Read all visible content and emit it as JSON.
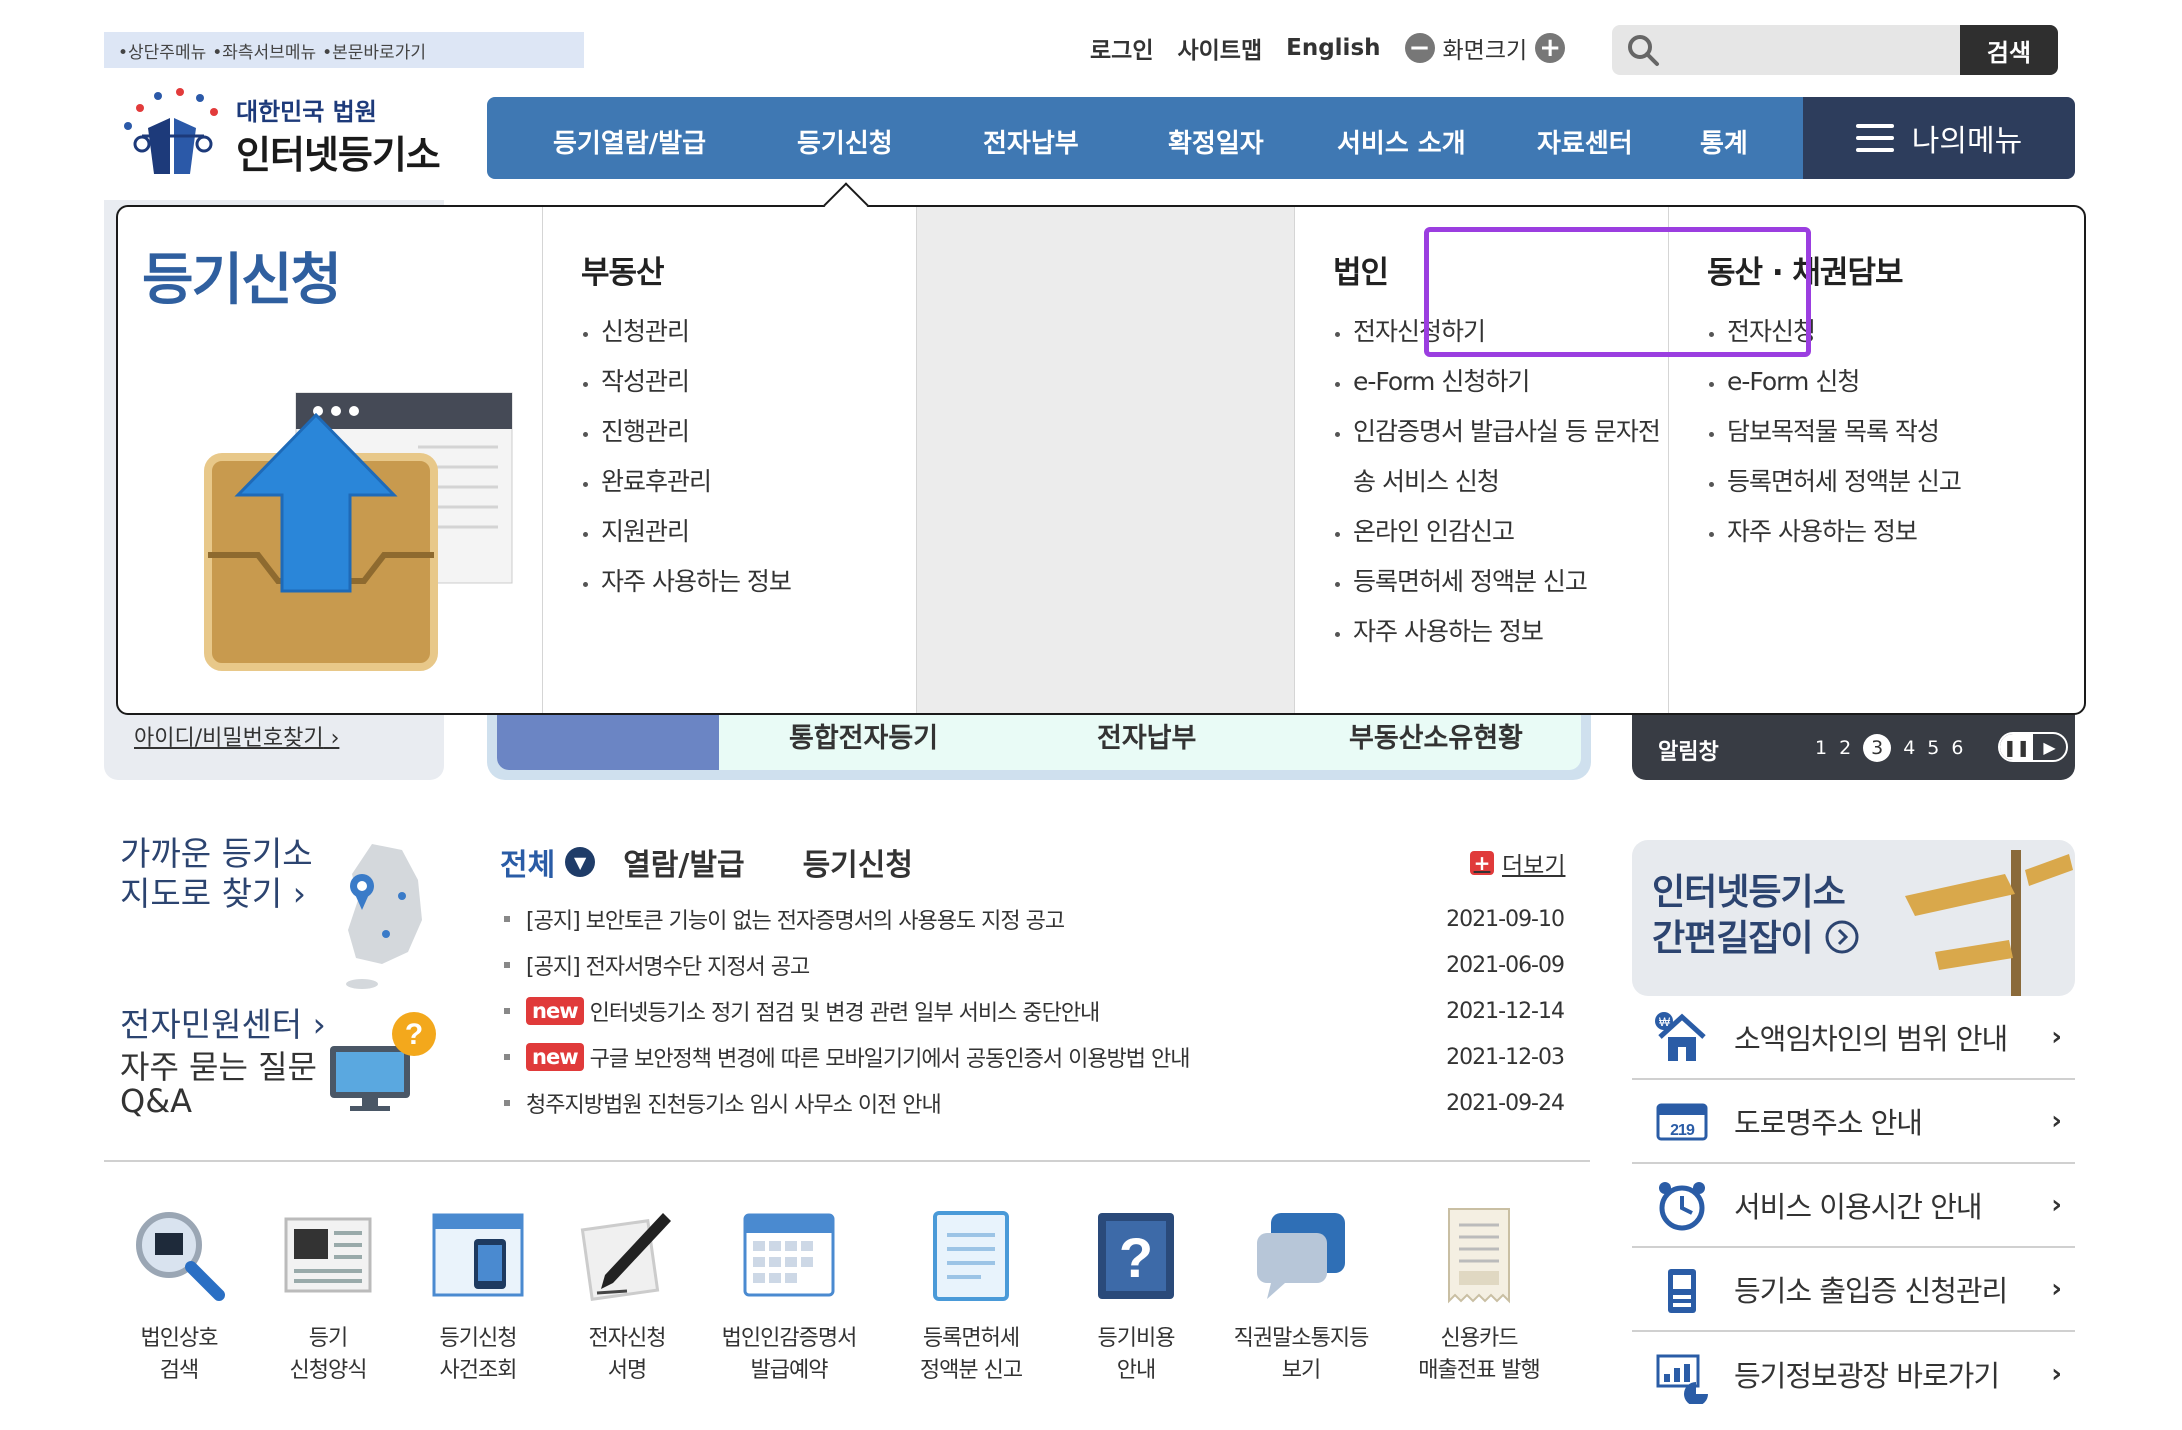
{
  "skipnav": [
    "•상단주메뉴",
    "•좌측서브메뉴",
    "•본문바로가기"
  ],
  "logo": {
    "sub": "대한민국 법원",
    "main": "인터넷등기소"
  },
  "util": {
    "login": "로그인",
    "sitemap": "사이트맵",
    "english": "English",
    "zoom_label": "화면크기",
    "zoom_out": "−",
    "zoom_in": "+"
  },
  "search": {
    "placeholder": "",
    "button": "검색"
  },
  "gnb": [
    "등기열람/발급",
    "등기신청",
    "전자납부",
    "확정일자",
    "서비스 소개",
    "자료센터",
    "통계"
  ],
  "mymenu": "나의메뉴",
  "dropdown": {
    "title": "등기신청",
    "columns": [
      {
        "heading": "부동산",
        "items": [
          "신청관리",
          "작성관리",
          "진행관리",
          "완료후관리",
          "지원관리",
          "자주 사용하는 정보"
        ]
      },
      {
        "heading": "법인",
        "items": [
          "전자신청하기",
          "e-Form 신청하기",
          "인감증명서 발급사실 등 문자전",
          "송 서비스 신청",
          "온라인 인감신고",
          "등록면허세 정액분 신고",
          "자주 사용하는 정보"
        ]
      },
      {
        "heading": "동산 · 채권담보",
        "items": [
          "전자신청",
          "e-Form 신청",
          "담보목적물 목록 작성",
          "등록면허세 정액분 신고",
          "자주 사용하는 정보"
        ]
      }
    ]
  },
  "background": {
    "id_link": "아이디/비밀번호찾기",
    "mid_tabs": [
      "통합전자등기",
      "전자납부",
      "부동산소유현황"
    ],
    "alarm": {
      "label": "알림창",
      "pages": [
        "1",
        "2",
        "3",
        "4",
        "5",
        "6"
      ],
      "current": "3"
    }
  },
  "left": {
    "map_line1": "가까운 등기소",
    "map_line2": "지도로 찾기",
    "center": "전자민원센터",
    "faq_line1": "자주 묻는 질문",
    "faq_line2": "Q&A",
    "arrow": "›"
  },
  "notice_tabs": [
    "전체",
    "열람/발급",
    "등기신청"
  ],
  "more": "더보기",
  "notices": [
    {
      "new": "",
      "title": "[공지] 보안토큰 기능이 없는 전자증명서의 사용용도 지정 공고",
      "date": "2021-09-10"
    },
    {
      "new": "",
      "title": "[공지] 전자서명수단 지정서 공고",
      "date": "2021-06-09"
    },
    {
      "new": "new",
      "title": "인터넷등기소 정기 점검 및 변경 관련 일부 서비스 중단안내",
      "date": "2021-12-14"
    },
    {
      "new": "new",
      "title": "구글 보안정책 변경에 따른 모바일기기에서 공동인증서 이용방법 안내",
      "date": "2021-12-03"
    },
    {
      "new": "",
      "title": "청주지방법원 진천등기소 임시 사무소 이전 안내",
      "date": "2021-09-24"
    }
  ],
  "guide": {
    "line1": "인터넷등기소",
    "line2": "간편길잡이"
  },
  "right_links": [
    {
      "label": "소액임차인의 범위 안내",
      "icon": "house-icon"
    },
    {
      "label": "도로명주소 안내",
      "icon": "address-sign-icon",
      "badge": "219"
    },
    {
      "label": "서비스 이용시간 안내",
      "icon": "clock-icon"
    },
    {
      "label": "등기소 출입증 신청관리",
      "icon": "badge-icon"
    },
    {
      "label": "등기정보광장 바로가기",
      "icon": "chart-icon"
    }
  ],
  "right_arrow": "›",
  "quick": [
    {
      "l1": "법인상호",
      "l2": "검색"
    },
    {
      "l1": "등기",
      "l2": "신청양식"
    },
    {
      "l1": "등기신청",
      "l2": "사건조회"
    },
    {
      "l1": "전자신청",
      "l2": "서명"
    },
    {
      "l1": "법인인감증명서",
      "l2": "발급예약"
    },
    {
      "l1": "등록면허세",
      "l2": "정액분 신고"
    },
    {
      "l1": "등기비용",
      "l2": "안내"
    },
    {
      "l1": "직권말소통지등",
      "l2": "보기"
    },
    {
      "l1": "신용카드",
      "l2": "매출전표 발행"
    }
  ],
  "colors": {
    "gnb": "#3f78b3",
    "mymenu": "#2d3d5c",
    "highlight": "#9b3ee0",
    "title": "#2f5f9f",
    "new_badge": "#e03a3a"
  }
}
